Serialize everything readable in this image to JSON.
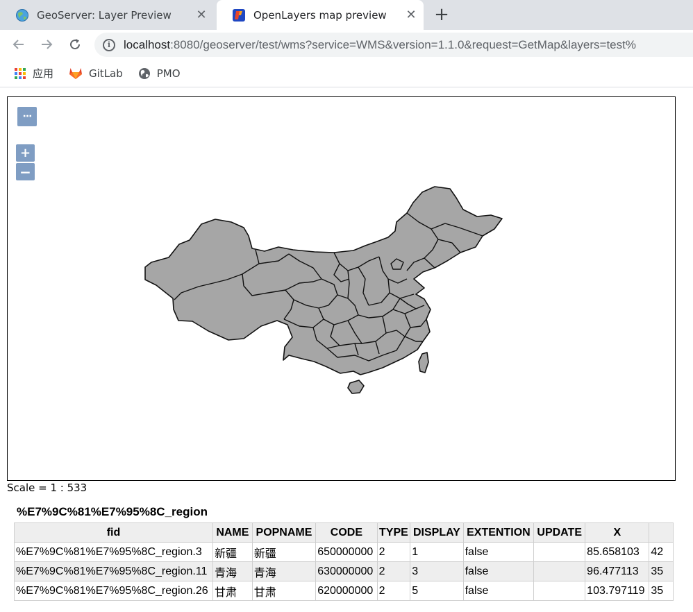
{
  "browser": {
    "tabs": [
      {
        "title": "GeoServer: Layer Preview",
        "active": false
      },
      {
        "title": "OpenLayers map preview",
        "active": true
      }
    ],
    "url_host": "localhost",
    "url_rest": ":8080/geoserver/test/wms?service=WMS&version=1.1.0&request=GetMap&layers=test%",
    "bookmarks": [
      {
        "label": "应用",
        "icon": "apps-grid-icon"
      },
      {
        "label": "GitLab",
        "icon": "gitlab-icon"
      },
      {
        "label": "PMO",
        "icon": "globe-icon"
      }
    ]
  },
  "map": {
    "controls": {
      "more": "···",
      "zoom_in": "+",
      "zoom_out": "−"
    },
    "fill_color": "#a6a6a6",
    "stroke_color": "#111111"
  },
  "scale_text": "Scale = 1 : 533",
  "layer_title": "%E7%9C%81%E7%95%8C_region",
  "table": {
    "headers": [
      "fid",
      "NAME",
      "POPNAME",
      "CODE",
      "TYPE",
      "DISPLAY",
      "EXTENTION",
      "UPDATE",
      "X",
      ""
    ],
    "rows": [
      [
        "%E7%9C%81%E7%95%8C_region.3",
        "新疆",
        "新疆",
        "650000000",
        "2",
        "1",
        "false",
        "",
        "85.658103",
        "42"
      ],
      [
        "%E7%9C%81%E7%95%8C_region.11",
        "青海",
        "青海",
        "630000000",
        "2",
        "3",
        "false",
        "",
        "96.477113",
        "35"
      ],
      [
        "%E7%9C%81%E7%95%8C_region.26",
        "甘肃",
        "甘肃",
        "620000000",
        "2",
        "5",
        "false",
        "",
        "103.797119",
        "35"
      ]
    ]
  }
}
